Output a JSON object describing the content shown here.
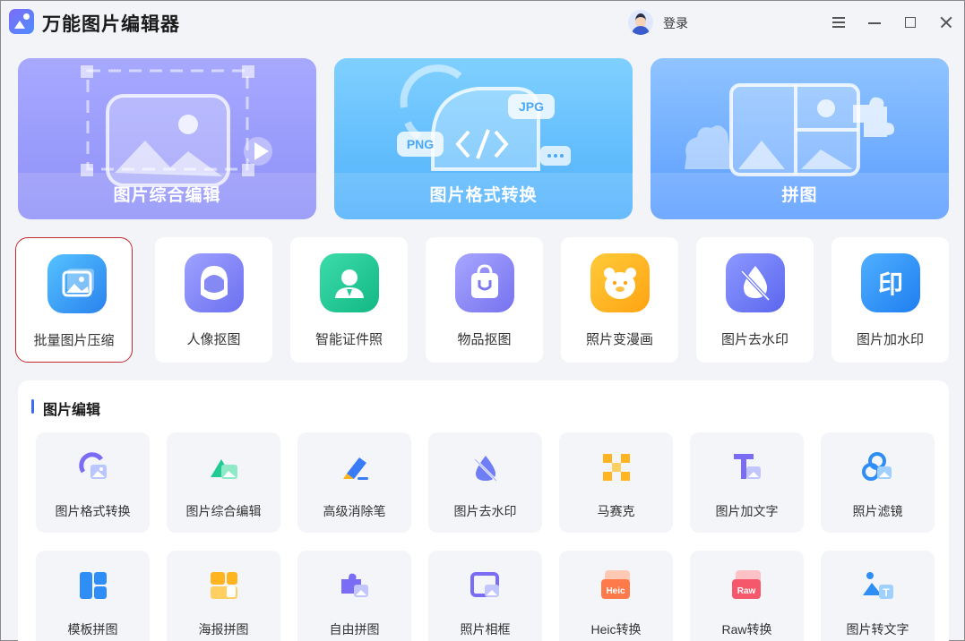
{
  "app": {
    "title": "万能图片编辑器",
    "login_label": "登录"
  },
  "window_controls": [
    "menu-icon",
    "minimize-icon",
    "maximize-icon",
    "close-icon"
  ],
  "banners": [
    {
      "label": "图片综合编辑",
      "icon": "image-edit-icon",
      "color": "#9a9cf9"
    },
    {
      "label": "图片格式转换",
      "icon": "format-convert-icon",
      "color": "#5fbbfc",
      "badges": [
        "JPG",
        "PNG"
      ]
    },
    {
      "label": "拼图",
      "icon": "collage-icon",
      "color": "#72adff"
    }
  ],
  "features": [
    {
      "label": "批量图片压缩",
      "icon": "batch-compress-icon",
      "color": "#2f93f4",
      "selected": true
    },
    {
      "label": "人像抠图",
      "icon": "portrait-cutout-icon",
      "color": "#7b7ff5"
    },
    {
      "label": "智能证件照",
      "icon": "id-photo-icon",
      "color": "#1fcb93"
    },
    {
      "label": "物品抠图",
      "icon": "object-cutout-icon",
      "color": "#8a86f6"
    },
    {
      "label": "照片变漫画",
      "icon": "cartoon-icon",
      "color": "#ffb420"
    },
    {
      "label": "图片去水印",
      "icon": "remove-watermark-icon",
      "color": "#6f7ef5"
    },
    {
      "label": "图片加水印",
      "icon": "add-watermark-icon",
      "color": "#2f8ef5",
      "glyph": "印"
    }
  ],
  "section": {
    "title": "图片编辑",
    "tools": [
      {
        "label": "图片格式转换",
        "icon": "format-convert-icon"
      },
      {
        "label": "图片综合编辑",
        "icon": "image-edit-icon"
      },
      {
        "label": "高级消除笔",
        "icon": "eraser-pen-icon"
      },
      {
        "label": "图片去水印",
        "icon": "remove-watermark-icon"
      },
      {
        "label": "马赛克",
        "icon": "mosaic-icon"
      },
      {
        "label": "图片加文字",
        "icon": "add-text-icon"
      },
      {
        "label": "照片滤镜",
        "icon": "filter-icon"
      },
      {
        "label": "模板拼图",
        "icon": "template-collage-icon"
      },
      {
        "label": "海报拼图",
        "icon": "poster-collage-icon"
      },
      {
        "label": "自由拼图",
        "icon": "free-collage-icon"
      },
      {
        "label": "照片相框",
        "icon": "photo-frame-icon"
      },
      {
        "label": "Heic转换",
        "icon": "heic-convert-icon",
        "badge": "Heic"
      },
      {
        "label": "Raw转换",
        "icon": "raw-convert-icon",
        "badge": "Raw"
      },
      {
        "label": "图片转文字",
        "icon": "image-to-text-icon"
      }
    ]
  }
}
